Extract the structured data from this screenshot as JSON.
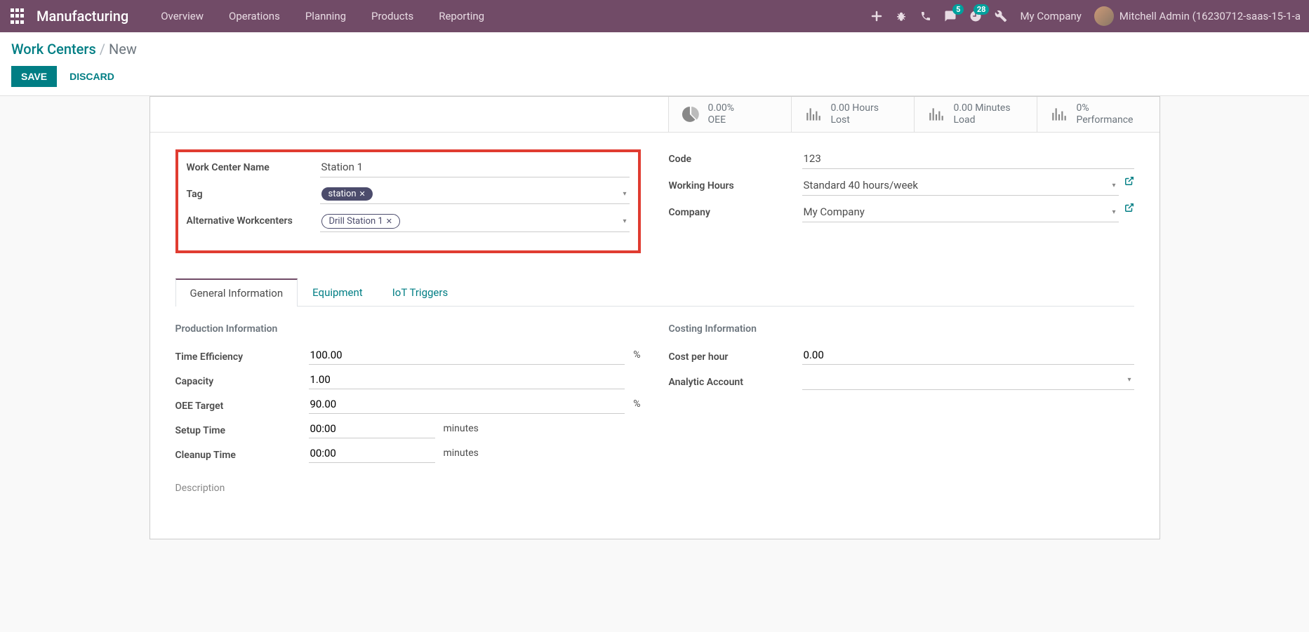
{
  "navbar": {
    "brand": "Manufacturing",
    "menu": [
      "Overview",
      "Operations",
      "Planning",
      "Products",
      "Reporting"
    ],
    "conversations_badge": "5",
    "activities_badge": "28",
    "company": "My Company",
    "user": "Mitchell Admin (16230712-saas-15-1-a"
  },
  "breadcrumb": {
    "root": "Work Centers",
    "sep": "/",
    "current": "New"
  },
  "actions": {
    "save": "SAVE",
    "discard": "DISCARD"
  },
  "stats": {
    "oee": {
      "value": "0.00%",
      "label": "OEE"
    },
    "lost": {
      "value": "0.00 Hours",
      "label": "Lost"
    },
    "load": {
      "value": "0.00 Minutes",
      "label": "Load"
    },
    "perf": {
      "value": "0%",
      "label": "Performance"
    }
  },
  "fields_left": {
    "name_label": "Work Center Name",
    "name_value": "Station 1",
    "tag_label": "Tag",
    "tag_value": "station",
    "alt_label": "Alternative Workcenters",
    "alt_value": "Drill Station 1"
  },
  "fields_right": {
    "code_label": "Code",
    "code_value": "123",
    "hours_label": "Working Hours",
    "hours_value": "Standard 40 hours/week",
    "company_label": "Company",
    "company_value": "My Company"
  },
  "tabs": {
    "general": "General Information",
    "equipment": "Equipment",
    "iot": "IoT Triggers"
  },
  "prod_info": {
    "section": "Production Information",
    "time_eff_label": "Time Efficiency",
    "time_eff_value": "100.00",
    "capacity_label": "Capacity",
    "capacity_value": "1.00",
    "oee_target_label": "OEE Target",
    "oee_target_value": "90.00",
    "setup_label": "Setup Time",
    "setup_value": "00:00",
    "cleanup_label": "Cleanup Time",
    "cleanup_value": "00:00",
    "percent_suffix": "%",
    "minutes_suffix": "minutes",
    "desc_label": "Description"
  },
  "cost_info": {
    "section": "Costing Information",
    "cost_label": "Cost per hour",
    "cost_value": "0.00",
    "analytic_label": "Analytic Account"
  }
}
